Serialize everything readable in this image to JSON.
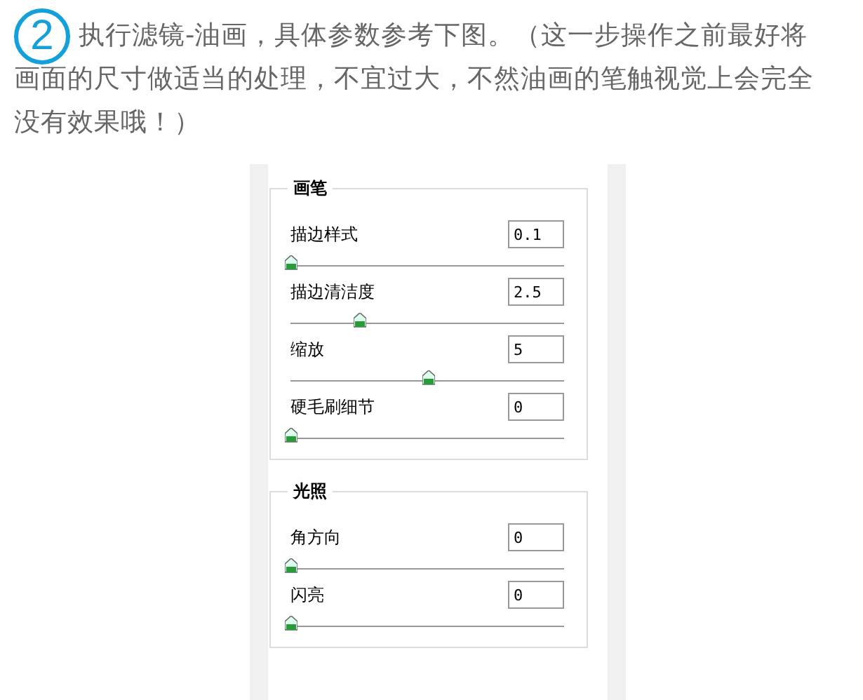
{
  "step": {
    "number": "2",
    "lines": [
      "执行滤镜-油画，具体参数参考下图。（这一步操作之前最好将",
      "画面的尺寸做适当的处理，不宜过大，不然油画的笔触视觉上会完全",
      "没有效果哦！）"
    ]
  },
  "groups": [
    {
      "title": "画笔",
      "params": [
        {
          "label": "描边样式",
          "value": "0.1",
          "level": 0
        },
        {
          "label": "描边清洁度",
          "value": "2.5",
          "level": 0.25
        },
        {
          "label": "缩放",
          "value": "5",
          "level": 0.5
        },
        {
          "label": "硬毛刷细节",
          "value": "0",
          "level": 0
        }
      ]
    },
    {
      "title": "光照",
      "params": [
        {
          "label": "角方向",
          "value": "0",
          "level": 0
        },
        {
          "label": "闪亮",
          "value": "0",
          "level": 0
        }
      ]
    }
  ]
}
